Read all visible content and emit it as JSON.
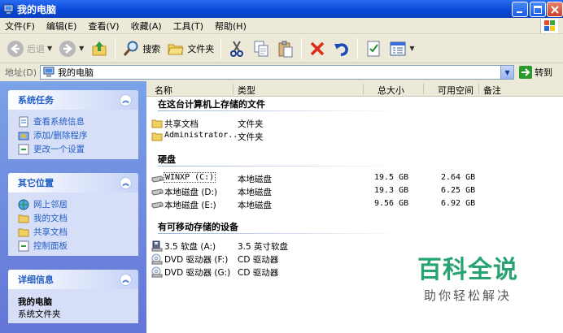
{
  "window": {
    "title": "我的电脑",
    "icon": "my-computer-icon"
  },
  "menu": [
    "文件(F)",
    "编辑(E)",
    "查看(V)",
    "收藏(A)",
    "工具(T)",
    "帮助(H)"
  ],
  "toolbar": {
    "back_label": "后退",
    "search_label": "搜索",
    "folders_label": "文件夹"
  },
  "address": {
    "label": "地址(D)",
    "value": "我的电脑",
    "go_label": "转到"
  },
  "tasks": {
    "system": {
      "title": "系统任务",
      "items": [
        "查看系统信息",
        "添加/删除程序",
        "更改一个设置"
      ]
    },
    "other": {
      "title": "其它位置",
      "items": [
        "网上邻居",
        "我的文档",
        "共享文档",
        "控制面板"
      ]
    },
    "details": {
      "title": "详细信息",
      "name": "我的电脑",
      "type": "系统文件夹"
    }
  },
  "columns": {
    "name": "名称",
    "type": "类型",
    "total": "总大小",
    "free": "可用空间",
    "comment": "备注"
  },
  "groups": {
    "files": {
      "title": "在这台计算机上存储的文件",
      "rows": [
        {
          "name": "共享文档",
          "type": "文件夹"
        },
        {
          "name": "Administrator...",
          "type": "文件夹"
        }
      ]
    },
    "drives": {
      "title": "硬盘",
      "rows": [
        {
          "name": "WINXP (C:)",
          "type": "本地磁盘",
          "total": "19.5 GB",
          "free": "2.64 GB"
        },
        {
          "name": "本地磁盘 (D:)",
          "type": "本地磁盘",
          "total": "19.3 GB",
          "free": "6.25 GB"
        },
        {
          "name": "本地磁盘 (E:)",
          "type": "本地磁盘",
          "total": "9.56 GB",
          "free": "6.92 GB"
        }
      ]
    },
    "removable": {
      "title": "有可移动存储的设备",
      "rows": [
        {
          "name": "3.5 软盘 (A:)",
          "type": "3.5 英寸软盘"
        },
        {
          "name": "DVD 驱动器 (F:)",
          "type": "CD 驱动器"
        },
        {
          "name": "DVD 驱动器 (G:)",
          "type": "CD 驱动器"
        }
      ]
    }
  },
  "watermark": {
    "title": "百科全说",
    "subtitle": "助你轻松解决"
  },
  "colors": {
    "titlebar": "#0a48d8",
    "taskpane": "#6f8fe0",
    "panel_header_text": "#215dc6",
    "watermark": "#2aa372"
  }
}
